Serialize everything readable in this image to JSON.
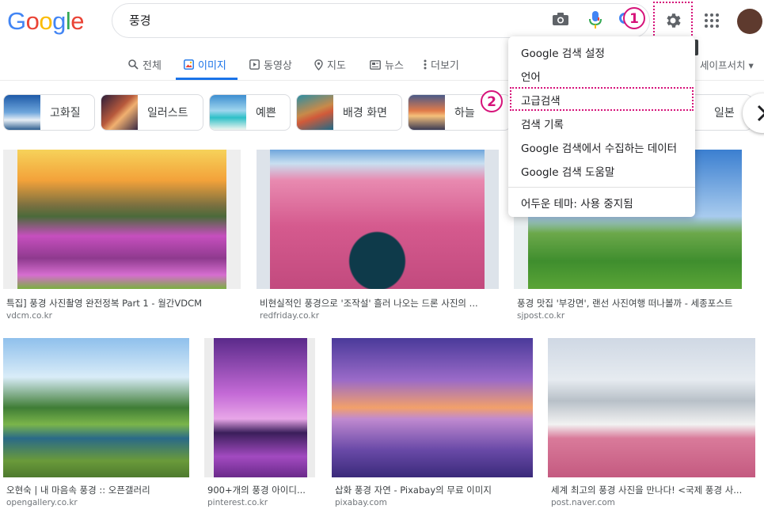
{
  "logo": {
    "letters": [
      "G",
      "o",
      "o",
      "g",
      "l",
      "e"
    ],
    "colors": [
      "#4285f4",
      "#ea4335",
      "#fbbc05",
      "#4285f4",
      "#34a853",
      "#ea4335"
    ]
  },
  "search": {
    "query": "풍경"
  },
  "annotations": {
    "badge1": "1",
    "badge2": "2",
    "color": "#d6137a"
  },
  "tabs": [
    {
      "label": "전체",
      "icon": "search-icon"
    },
    {
      "label": "이미지",
      "icon": "image-icon",
      "active": true
    },
    {
      "label": "동영상",
      "icon": "video-icon"
    },
    {
      "label": "지도",
      "icon": "map-pin-icon"
    },
    {
      "label": "뉴스",
      "icon": "news-icon"
    },
    {
      "label": "더보기",
      "icon": "more-vert-icon"
    }
  ],
  "safesearch_label": "세이프서치 ▾",
  "chips": [
    {
      "label": "고화질"
    },
    {
      "label": "일러스트"
    },
    {
      "label": "예쁜"
    },
    {
      "label": "배경 화면"
    },
    {
      "label": "하늘"
    },
    {
      "label": "일본"
    }
  ],
  "settings_menu": {
    "items": [
      "Google 검색 설정",
      "언어",
      "고급검색",
      "검색 기록",
      "Google 검색에서 수집하는 데이터",
      "Google 검색 도움말"
    ],
    "dark_theme": "어두운 테마: 사용 중지됨"
  },
  "results": [
    {
      "title": "특집] 풍경 사진촬영 완전정복 Part 1 - 월간VDCM",
      "source": "vdcm.co.kr"
    },
    {
      "title": "비현실적인 풍경으로 '조작설' 흘러 나오는 드론 사진의 ...",
      "source": "redfriday.co.kr"
    },
    {
      "title": "풍경 맛집 '부강면', 랜선 사진여행 떠나볼까 - 세종포스트",
      "source": "sjpost.co.kr"
    },
    {
      "title": "오현숙 | 내 마음속 풍경 :: 오픈갤러리",
      "source": "opengallery.co.kr"
    },
    {
      "title": "900+개의 풍경 아이디...",
      "source": "pinterest.co.kr"
    },
    {
      "title": "삽화 풍경 자연 - Pixabay의 무료 이미지",
      "source": "pixabay.com"
    },
    {
      "title": "세계 최고의 풍경 사진을 만나다! <국제 풍경 사...",
      "source": "post.naver.com"
    }
  ]
}
